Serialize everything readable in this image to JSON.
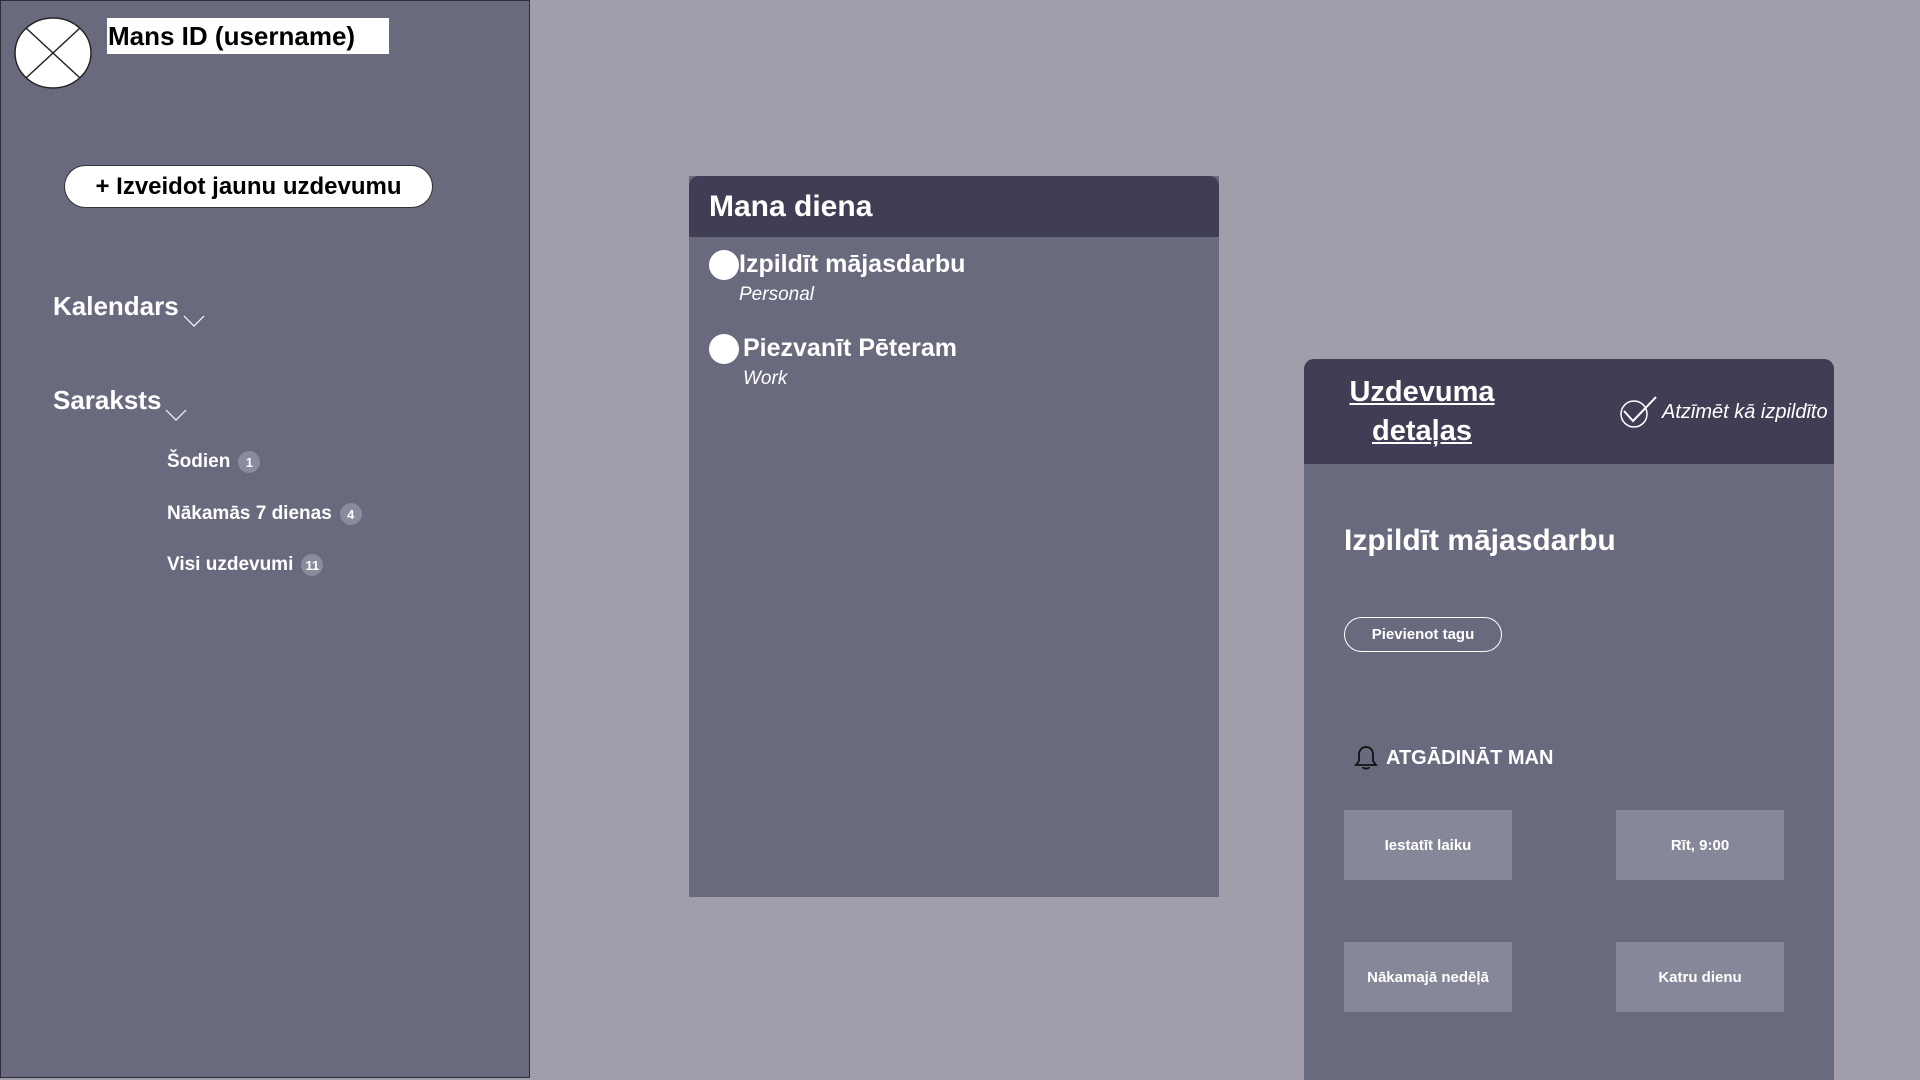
{
  "sidebar": {
    "username": "Mans ID (username)",
    "new_task_label": "+ Izveidot jaunu uzdevumu",
    "calendar_label": "Kalendars",
    "list_label": "Saraksts",
    "items": [
      {
        "label": "Šodien",
        "count": "1"
      },
      {
        "label": "Nākamās 7 dienas",
        "count": "4"
      },
      {
        "label": "Visi uzdevumi",
        "count": "11"
      }
    ]
  },
  "day": {
    "title": "Mana diena",
    "tasks": [
      {
        "title": "Izpildīt mājasdarbu",
        "category": "Personal"
      },
      {
        "title": "Piezvanīt Pēteram",
        "category": "Work"
      }
    ]
  },
  "details": {
    "title_line1": "Uzdevuma",
    "title_line2": "detaļas",
    "mark_done_label": "Atzīmēt kā izpildīto",
    "task_name": "Izpildīt mājasdarbu",
    "add_tag_label": "Pievienot tagu",
    "remind_label": "ATGĀDINĀT MAN",
    "options": [
      "Iestatīt laiku",
      "Rīt, 9:00",
      "Nākamajā nedēļā",
      "Katru dienu"
    ]
  },
  "colors": {
    "background": "#a29dab",
    "panel": "#696a7e",
    "header": "#403e54",
    "option": "#868799"
  }
}
